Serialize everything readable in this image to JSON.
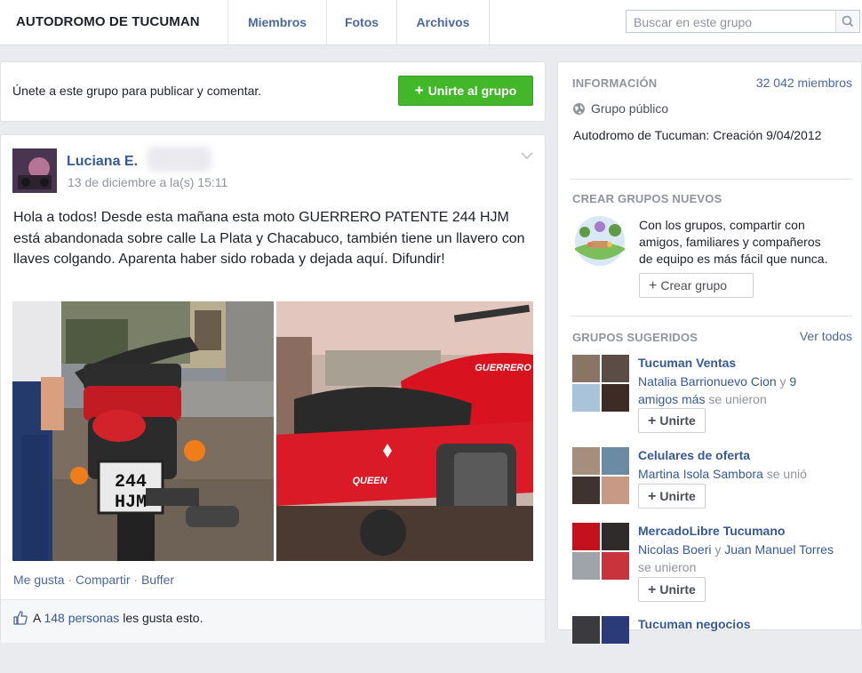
{
  "header": {
    "group_name": "AUTODROMO DE TUCUMAN",
    "tabs": [
      "Miembros",
      "Fotos",
      "Archivos"
    ],
    "search_placeholder": "Buscar en este grupo"
  },
  "join": {
    "prompt": "Únete a este grupo para publicar y comentar.",
    "button_label": "Unirte al grupo"
  },
  "post": {
    "author": "Luciana E.",
    "timestamp": "13 de diciembre a la(s) 15:11",
    "text": "Hola a todos! Desde esta mañana esta moto GUERRERO PATENTE 244 HJM está abandonada sobre calle La Plata y Chacabuco, también tiene un llavero con llaves colgando. Aparenta haber sido robada y dejada aquí. Difundir!",
    "plate": [
      "244",
      "HJM"
    ],
    "tank_logo": "GUERRERO",
    "side_logo": "QUEEN",
    "actions": [
      "Me gusta",
      "Compartir",
      "Buffer"
    ],
    "likes_prefix": "A",
    "likes_link": "148 personas",
    "likes_suffix": "les gusta esto."
  },
  "sidebar": {
    "info": {
      "title": "INFORMACIÓN",
      "members": "32 042 miembros",
      "privacy": "Grupo público",
      "description": "Autodromo de Tucuman: Creación 9/04/2012"
    },
    "create": {
      "title": "CREAR GRUPOS NUEVOS",
      "text_lines": [
        "Con los grupos, compartir con",
        "amigos, familiares y compañeros",
        "de equipo es más fácil que nunca."
      ],
      "button_label": "Crear grupo"
    },
    "suggested": {
      "title": "GRUPOS SUGERIDOS",
      "see_all": "Ver todos",
      "join_label": "Unirte",
      "groups": [
        {
          "name": "Tucuman Ventas",
          "member_link": "Natalia Barrionuevo Cion",
          "connector": "y",
          "others_link": "9",
          "line2_link": "amigos más",
          "line2_tail": "se unieron"
        },
        {
          "name": "Celulares de oferta",
          "member_link": "Martina Isola Sambora",
          "tail": "se unió"
        },
        {
          "name": "MercadoLibre Tucumano",
          "member_link": "Nicolas Boeri",
          "connector": "y",
          "member2_link": "Juan Manuel Torres",
          "line2_tail": "se unieron"
        },
        {
          "name": "Tucuman negocios"
        }
      ]
    }
  }
}
